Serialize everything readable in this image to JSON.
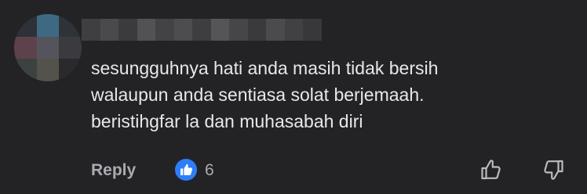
{
  "comment": {
    "text": "sesungguhnya hati anda masih tidak bersih\nwalaupun anda sentiasa solat berjemaah.\nberistihgfar la dan muhasabah diri",
    "reply_label": "Reply",
    "like_count": "6"
  },
  "avatar": {
    "pixel_colors": [
      "#2e3137",
      "#3d6a82",
      "#2f3338",
      "#5d414b",
      "#55535b",
      "#3a3a3f",
      "#3d4140",
      "#53524c",
      "#2a2a2c"
    ]
  },
  "author_name_blur": {
    "pixel_colors": [
      "#3f3f42",
      "#4a4a4d",
      "#3b3b3e",
      "#525255",
      "#434346",
      "#4d4d50",
      "#3e3e41",
      "#555558",
      "#464649",
      "#3a3a3d",
      "#4b4b4e",
      "#414144",
      "#38383b"
    ]
  },
  "icons": {
    "like_badge": "thumbs-up-badge-icon",
    "upvote": "thumbs-up-outline-icon",
    "downvote": "thumbs-down-outline-icon"
  },
  "colors": {
    "background": "#232326",
    "text": "#e7e8eb",
    "muted": "#a9abb0",
    "like_blue": "#2d7ff9"
  }
}
